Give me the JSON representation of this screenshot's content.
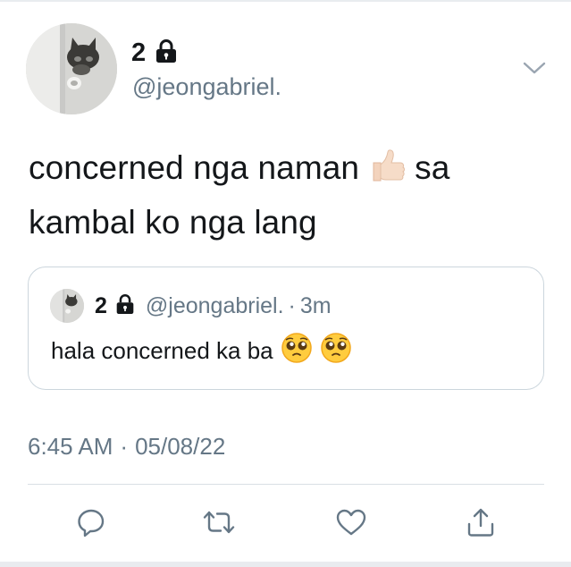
{
  "author": {
    "display_name": "2",
    "handle": "@jeongabriel.",
    "protected_icon": "lock-icon"
  },
  "tweet": {
    "text_line1_part1": "concerned nga naman",
    "text_line1_part2": "sa",
    "text_line2": "kambal ko nga lang",
    "emoji": "thumbs-up-light-skin-tone"
  },
  "quoted_tweet": {
    "display_name": "2",
    "handle": "@jeongabriel.",
    "separator": "·",
    "time": "3m",
    "text": "hala concerned ka ba",
    "emojis": [
      "pleading-face",
      "pleading-face"
    ]
  },
  "meta": {
    "time": "6:45 AM",
    "separator": "·",
    "date": "05/08/22"
  },
  "actions": {
    "reply_icon": "reply-icon",
    "retweet_icon": "retweet-icon",
    "like_icon": "heart-icon",
    "share_icon": "share-icon"
  },
  "colors": {
    "primary_text": "#14171a",
    "secondary_text": "#657786",
    "border": "#ccd6dd",
    "icon": "#657786"
  }
}
